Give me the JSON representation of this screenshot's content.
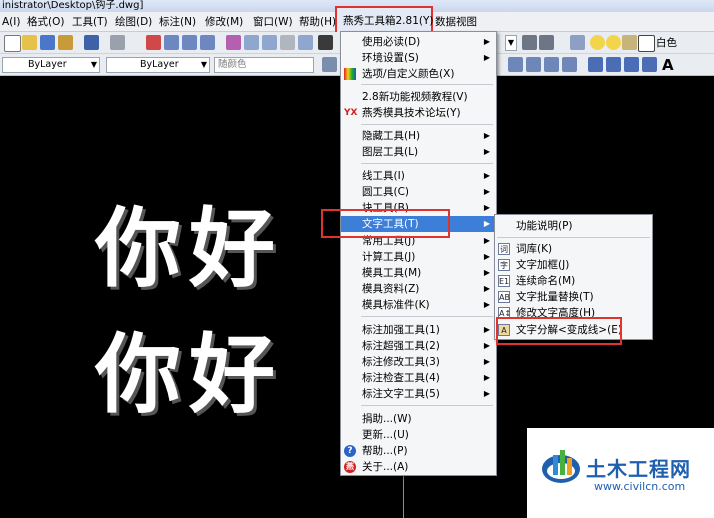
{
  "window": {
    "title": "inistrator\\Desktop\\钩子.dwg]"
  },
  "menubar": {
    "items": [
      "A(I)",
      "格式(O)",
      "工具(T)",
      "绘图(D)",
      "标注(N)",
      "修改(M)",
      "窗口(W)",
      "帮助(H)",
      "燕秀工具箱2.81(Y)",
      "数据视图"
    ]
  },
  "toolbar": {
    "layer_combo": "ByLayer",
    "linetype_combo": "ByLayer",
    "color_combo": "随颜色",
    "right_color": "白色"
  },
  "canvas": {
    "text_line1": "你好",
    "text_line2": "你好"
  },
  "main_menu": {
    "items": [
      {
        "label": "使用必读(D)",
        "submenu": true
      },
      {
        "label": "环境设置(S)",
        "submenu": true
      },
      {
        "label": "选项/自定义颜色(X)",
        "submenu": false,
        "icon": "palette-icon"
      },
      {
        "label": "2.8新功能视频教程(V)",
        "submenu": false
      },
      {
        "label": "燕秀模具技术论坛(Y)",
        "submenu": false,
        "icon": "yx-logo-icon",
        "icon_text": "YX"
      },
      {
        "label": "隐藏工具(H)",
        "submenu": true
      },
      {
        "label": "图层工具(L)",
        "submenu": true
      },
      {
        "label": "线工具(I)",
        "submenu": true
      },
      {
        "label": "圆工具(C)",
        "submenu": true
      },
      {
        "label": "块工具(B)",
        "submenu": true
      },
      {
        "label": "文字工具(T)",
        "submenu": true,
        "highlighted": true
      },
      {
        "label": "常用工具(J)",
        "submenu": true
      },
      {
        "label": "计算工具(J)",
        "submenu": true
      },
      {
        "label": "模具工具(M)",
        "submenu": true
      },
      {
        "label": "模具资料(Z)",
        "submenu": true
      },
      {
        "label": "模具标准件(K)",
        "submenu": true
      },
      {
        "label": "标注加强工具(1)",
        "submenu": true
      },
      {
        "label": "标注超强工具(2)",
        "submenu": true
      },
      {
        "label": "标注修改工具(3)",
        "submenu": true
      },
      {
        "label": "标注检查工具(4)",
        "submenu": true
      },
      {
        "label": "标注文字工具(5)",
        "submenu": true
      },
      {
        "label": "捐助...(W)",
        "submenu": false
      },
      {
        "label": "更新...(U)",
        "submenu": false
      },
      {
        "label": "帮助...(P)",
        "submenu": false,
        "icon": "help-icon",
        "icon_text": "?"
      },
      {
        "label": "关于...(A)",
        "submenu": false,
        "icon": "about-icon",
        "icon_text": "燕"
      }
    ]
  },
  "sub_menu": {
    "items": [
      {
        "label": "功能说明(P)",
        "icon_text": ""
      },
      {
        "label": "词库(K)",
        "icon_text": "词"
      },
      {
        "label": "文字加框(J)",
        "icon_text": "字"
      },
      {
        "label": "连续命名(M)",
        "icon_text": "E1"
      },
      {
        "label": "文字批量替换(T)",
        "icon_text": "AB"
      },
      {
        "label": "修改文字高度(H)",
        "icon_text": "A↕"
      },
      {
        "label": "文字分解<变成线>(E)",
        "icon_text": "A"
      }
    ]
  },
  "watermark": {
    "title": "土木工程网",
    "url": "www.civilcn.com"
  },
  "colors": {
    "highlight": "#3d7fd8",
    "annotation_frame": "#e0322e",
    "canvas": "#000000",
    "watermark_blue": "#1f5fb0"
  }
}
